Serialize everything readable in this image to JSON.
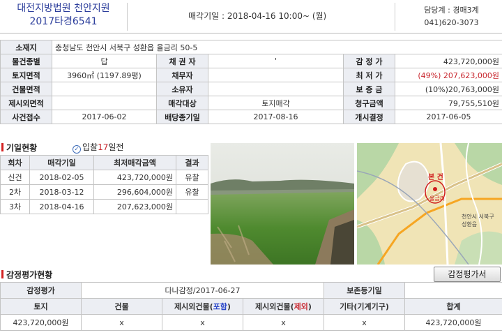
{
  "header": {
    "court": "대전지방법원 천안지원",
    "case_no": "2017타경6541",
    "sale_date": "매각기일 : 2018-04-16   10:00~ (월)",
    "dept": "담당계 : 경매3계",
    "phone": "041)620-3073"
  },
  "info": {
    "location_label": "소재지",
    "location": "충청남도 천안시 서북구 성환읍 율금리 50-5",
    "type_label": "물건종별",
    "type": "답",
    "creditor_label": "채 권 자",
    "creditor": "'",
    "appraisal_label": "감 정 가",
    "appraisal": "423,720,000원",
    "land_area_label": "토지면적",
    "land_area": "3960㎡ (1197.89평)",
    "debtor_label": "채무자",
    "debtor": "",
    "min_price_label": "최 저 가",
    "min_price": "(49%) 207,623,000원",
    "bldg_area_label": "건물면적",
    "bldg_area": "",
    "owner_label": "소유자",
    "owner": "",
    "deposit_label": "보 증 금",
    "deposit": "(10%)20,763,000원",
    "excl_area_label": "제시외면적",
    "excl_area": "",
    "sale_target_label": "매각대상",
    "sale_target": "토지매각",
    "claim_label": "청구금액",
    "claim": "79,755,510원",
    "filed_label": "사건접수",
    "filed": "2017-06-02",
    "dividend_label": "배당종기일",
    "dividend": "2017-08-16",
    "start_label": "개시결정",
    "start": "2017-06-05"
  },
  "history": {
    "title": "기일현황",
    "badge_prefix": "입찰",
    "badge_num": "17",
    "badge_suffix": "일전",
    "headers": [
      "회차",
      "매각기일",
      "최저매각금액",
      "결과"
    ],
    "rows": [
      [
        "신건",
        "2018-02-05",
        "423,720,000원",
        "유찰"
      ],
      [
        "2차",
        "2018-03-12",
        "296,604,000원",
        "유찰"
      ],
      [
        "3차",
        "2018-04-16",
        "207,623,000원",
        ""
      ]
    ]
  },
  "map": {
    "marker_label": "본 건",
    "pin_label": "율금리",
    "place_label": "천안시 서북구 성환읍"
  },
  "appraisal": {
    "title": "감정평가현황",
    "button": "감정평가서",
    "row1": [
      "감정평가",
      "다나감정/2017-06-27",
      "보존등기일",
      ""
    ],
    "headers": [
      "토지",
      "건물",
      "제시외건물(",
      "포함",
      ")",
      "제시외건물(",
      "제외",
      ")",
      "기타(기계기구)",
      "합계"
    ],
    "values": [
      "423,720,000원",
      "x",
      "x",
      "x",
      "x",
      "423,720,000원"
    ]
  }
}
